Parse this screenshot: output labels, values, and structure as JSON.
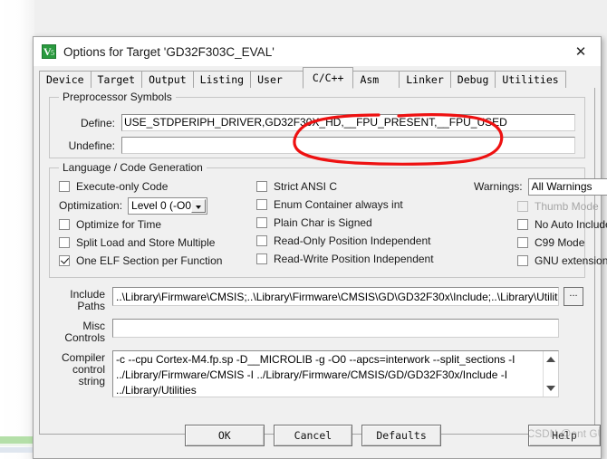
{
  "window": {
    "title": "Options for Target 'GD32F303C_EVAL'",
    "app_icon": "keil-uvision-icon",
    "close_label": "✕"
  },
  "tabs": [
    {
      "label": "Device",
      "active": false
    },
    {
      "label": "Target",
      "active": false
    },
    {
      "label": "Output",
      "active": false
    },
    {
      "label": "Listing",
      "active": false
    },
    {
      "label": "User",
      "active": false
    },
    {
      "label": "C/C++",
      "active": true
    },
    {
      "label": "Asm",
      "active": false
    },
    {
      "label": "Linker",
      "active": false
    },
    {
      "label": "Debug",
      "active": false
    },
    {
      "label": "Utilities",
      "active": false
    }
  ],
  "preprocessor": {
    "legend": "Preprocessor Symbols",
    "define_label": "Define:",
    "define_value": "USE_STDPERIPH_DRIVER,GD32F30X_HD,__FPU_PRESENT,__FPU_USED",
    "undefine_label": "Undefine:",
    "undefine_value": ""
  },
  "language": {
    "legend": "Language / Code Generation",
    "col1": [
      {
        "label": "Execute-only Code",
        "checked": false,
        "disabled": false
      },
      {
        "label": "Optimize for Time",
        "checked": false,
        "disabled": false
      },
      {
        "label": "Split Load and Store Multiple",
        "checked": false,
        "disabled": false
      },
      {
        "label": "One ELF Section per Function",
        "checked": true,
        "disabled": false
      }
    ],
    "optimization_label": "Optimization:",
    "optimization_value": "Level 0 (-O0)",
    "col2": [
      {
        "label": "Strict ANSI C",
        "checked": false,
        "disabled": false
      },
      {
        "label": "Enum Container always int",
        "checked": false,
        "disabled": false
      },
      {
        "label": "Plain Char is Signed",
        "checked": false,
        "disabled": false
      },
      {
        "label": "Read-Only Position Independent",
        "checked": false,
        "disabled": false
      },
      {
        "label": "Read-Write Position Independent",
        "checked": false,
        "disabled": false
      }
    ],
    "warnings_label": "Warnings:",
    "warnings_value": "All Warnings",
    "col3": [
      {
        "label": "Thumb Mode",
        "checked": false,
        "disabled": true
      },
      {
        "label": "No Auto Includes",
        "checked": false,
        "disabled": false
      },
      {
        "label": "C99 Mode",
        "checked": false,
        "disabled": false
      },
      {
        "label": "GNU extensions",
        "checked": false,
        "disabled": false
      }
    ]
  },
  "paths": {
    "include_label_line1": "Include",
    "include_label_line2": "Paths",
    "include_value": "..\\Library\\Firmware\\CMSIS;..\\Library\\Firmware\\CMSIS\\GD\\GD32F30x\\Include;..\\Library\\Utilities;..\\;.",
    "browse_label": "...",
    "misc_label_line1": "Misc",
    "misc_label_line2": "Controls",
    "misc_value": "",
    "compiler_label_line1": "Compiler",
    "compiler_label_line2": "control",
    "compiler_label_line3": "string",
    "compiler_value": "-c --cpu Cortex-M4.fp.sp -D__MICROLIB -g -O0 --apcs=interwork --split_sections -I ../Library/Firmware/CMSIS -I ../Library/Firmware/CMSIS/GD/GD32F30x/Include -I ../Library/Utilities"
  },
  "footer": {
    "ok_label": "OK",
    "cancel_label": "Cancel",
    "defaults_label": "Defaults",
    "help_label": "Help",
    "watermark": "CSDN @ent GU"
  },
  "annotation": {
    "type": "hand-drawn-ellipse",
    "color": "#ee1111",
    "target": "__FPU_PRESENT,__FPU_USED"
  }
}
